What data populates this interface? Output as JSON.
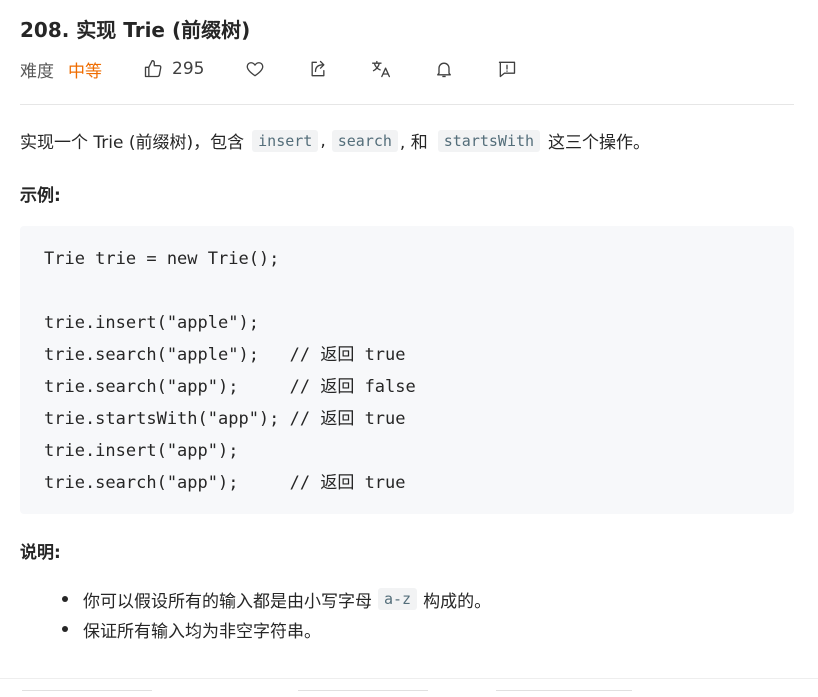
{
  "problem": {
    "title": "208. 实现 Trie (前缀树)",
    "difficulty_label": "难度",
    "difficulty_value": "中等",
    "likes": "295",
    "icons": [
      "thumbs-up-icon",
      "heart-icon",
      "share-icon",
      "translate-icon",
      "bell-icon",
      "feedback-icon"
    ],
    "colors": {
      "difficulty": "#ef6c00",
      "code_bg": "#f7f8fa",
      "inline_code_fg": "#546e7a"
    }
  },
  "description": {
    "prefix": "实现一个 Trie (前缀树)，包含",
    "code_insert": "insert",
    "sep1": ",",
    "code_search": "search",
    "sep2": ", 和",
    "code_startsWith": "startsWith",
    "suffix": "这三个操作。"
  },
  "example": {
    "heading": "示例:",
    "lines": [
      "Trie trie = new Trie();",
      "",
      "trie.insert(\"apple\");",
      "trie.search(\"apple\");   // 返回 true",
      "trie.search(\"app\");     // 返回 false",
      "trie.startsWith(\"app\"); // 返回 true",
      "trie.insert(\"app\");",
      "trie.search(\"app\");     // 返回 true"
    ]
  },
  "notes": {
    "heading": "说明:",
    "item1_prefix": "你可以假设所有的输入都是由小写字母",
    "item1_code": "a-z",
    "item1_suffix": "构成的。",
    "item2": "保证所有输入均为非空字符串。"
  }
}
